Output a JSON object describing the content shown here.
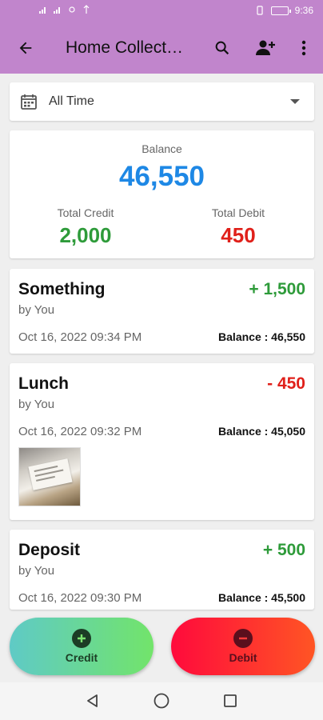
{
  "status": {
    "time": "9:36"
  },
  "appbar": {
    "title": "Home Collect…"
  },
  "filter": {
    "label": "All Time"
  },
  "summary": {
    "balance_label": "Balance",
    "balance_value": "46,550",
    "credit_label": "Total Credit",
    "credit_value": "2,000",
    "debit_label": "Total Debit",
    "debit_value": "450"
  },
  "transactions": [
    {
      "name": "Something",
      "by": "by You",
      "amount": "+ 1,500",
      "type": "credit",
      "date": "Oct 16, 2022 09:34 PM",
      "balance": "Balance : 46,550"
    },
    {
      "name": "Lunch",
      "by": "by You",
      "amount": "- 450",
      "type": "debit",
      "date": "Oct 16, 2022 09:32 PM",
      "balance": "Balance : 45,050"
    },
    {
      "name": "Deposit",
      "by": "by You",
      "amount": "+ 500",
      "type": "credit",
      "date": "Oct 16, 2022 09:30 PM",
      "balance": "Balance : 45,500"
    }
  ],
  "actions": {
    "credit_label": "Credit",
    "debit_label": "Debit"
  },
  "colors": {
    "header": "#c185cc",
    "balance": "#1e88e5",
    "credit": "#2e9b3a",
    "debit": "#e0201a"
  }
}
